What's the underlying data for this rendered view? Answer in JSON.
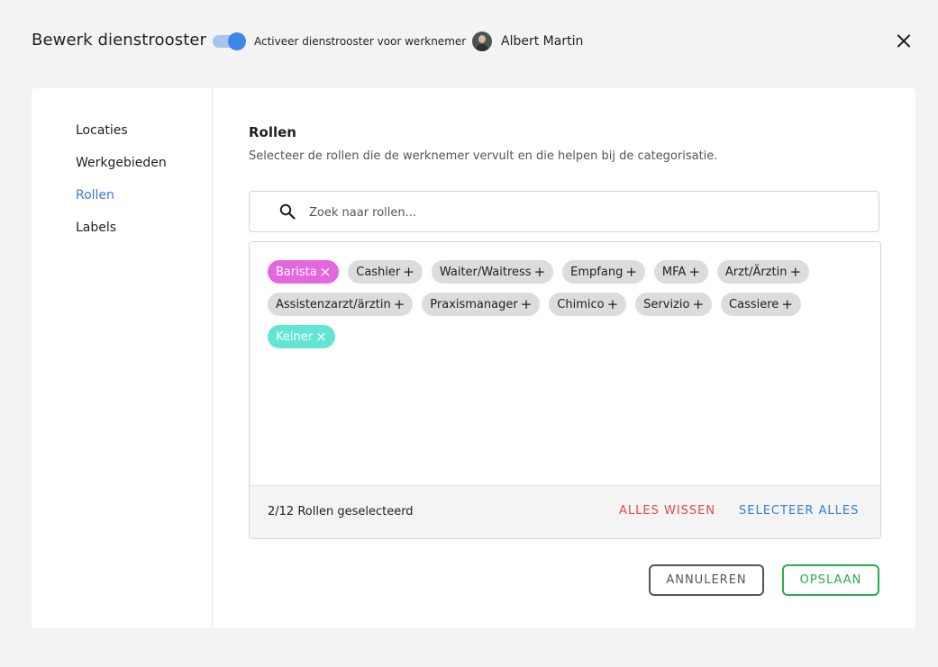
{
  "header": {
    "title": "Bewerk dienstrooster",
    "toggle_label": "Activeer dienstrooster voor werknemer",
    "toggle_on": true,
    "user_name": "Albert Martin"
  },
  "sidebar": {
    "items": [
      {
        "label": "Locaties",
        "active": false
      },
      {
        "label": "Werkgebieden",
        "active": false
      },
      {
        "label": "Rollen",
        "active": true
      },
      {
        "label": "Labels",
        "active": false
      }
    ]
  },
  "main": {
    "section_title": "Rollen",
    "section_description": "Selecteer de rollen die de werknemer vervult en die helpen bij de categorisatie.",
    "search_placeholder": "Zoek naar rollen...",
    "roles": [
      {
        "label": "Barista",
        "selected": true,
        "color": "#e467e0"
      },
      {
        "label": "Cashier",
        "selected": false
      },
      {
        "label": "Waiter/Waitress",
        "selected": false
      },
      {
        "label": "Empfang",
        "selected": false
      },
      {
        "label": "MFA",
        "selected": false
      },
      {
        "label": "Arzt/Ärztin",
        "selected": false
      },
      {
        "label": "Assistenzarzt/ärztin",
        "selected": false
      },
      {
        "label": "Praxismanager",
        "selected": false
      },
      {
        "label": "Chimico",
        "selected": false
      },
      {
        "label": "Servizio",
        "selected": false
      },
      {
        "label": "Cassiere",
        "selected": false
      },
      {
        "label": "Kelner",
        "selected": true,
        "color": "#62e6d3"
      }
    ],
    "selected_count_text": "2/12 Rollen geselecteerd",
    "clear_all_label": "ALLES WISSEN",
    "select_all_label": "SELECTEER ALLES"
  },
  "actions": {
    "cancel_label": "ANNULEREN",
    "save_label": "OPSLAAN"
  },
  "colors": {
    "accent_blue": "#3a7bd5",
    "danger_red": "#e8474f",
    "save_green": "#22b14c"
  }
}
